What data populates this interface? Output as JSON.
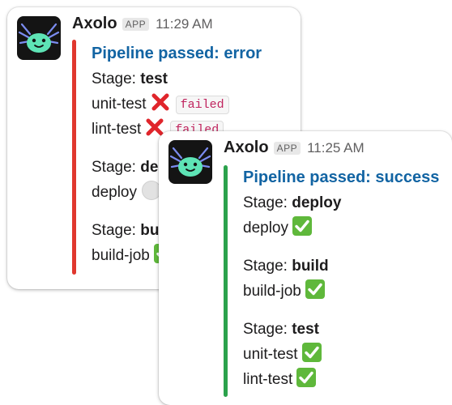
{
  "messages": [
    {
      "bot_name": "Axolo",
      "badge": "APP",
      "time": "11:29 AM",
      "accent_color": "#e0372e",
      "title": "Pipeline passed: error",
      "stages": [
        {
          "label": "Stage: ",
          "name": "test",
          "jobs": [
            {
              "name": "unit-test",
              "status": "failed",
              "tag": "failed"
            },
            {
              "name": "lint-test",
              "status": "failed",
              "tag": "failed"
            }
          ]
        },
        {
          "label": "Stage: ",
          "name": "deploy",
          "jobs": [
            {
              "name": "deploy",
              "status": "skipped"
            }
          ]
        },
        {
          "label": "Stage: ",
          "name": "build",
          "jobs": [
            {
              "name": "build-job",
              "status": "success"
            }
          ]
        }
      ]
    },
    {
      "bot_name": "Axolo",
      "badge": "APP",
      "time": "11:25 AM",
      "accent_color": "#2ba24c",
      "title": "Pipeline passed: success",
      "stages": [
        {
          "label": "Stage: ",
          "name": "deploy",
          "jobs": [
            {
              "name": "deploy",
              "status": "success"
            }
          ]
        },
        {
          "label": "Stage: ",
          "name": "build",
          "jobs": [
            {
              "name": "build-job",
              "status": "success"
            }
          ]
        },
        {
          "label": "Stage: ",
          "name": "test",
          "jobs": [
            {
              "name": "unit-test",
              "status": "success"
            },
            {
              "name": "lint-test",
              "status": "success"
            }
          ]
        }
      ]
    }
  ],
  "icons": {
    "avatar": "axolotl-avatar-icon",
    "success": "check-mark-button-icon",
    "failed": "cross-mark-icon"
  }
}
